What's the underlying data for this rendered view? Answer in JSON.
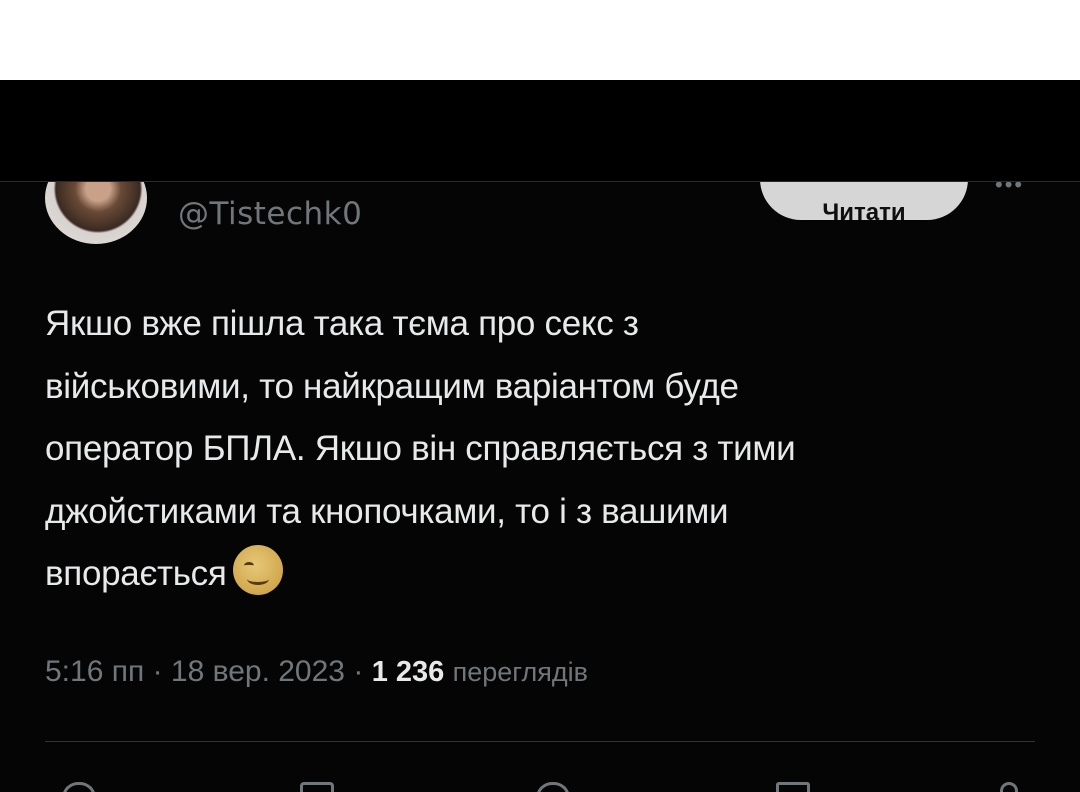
{
  "profile": {
    "handle": "@Tistechk0",
    "follow_button_label": "Читати"
  },
  "tweet": {
    "text_lines": [
      "Якшо вже пішла така тєма про секс з",
      "військовими, то найкращим варіантом буде",
      "оператор БПЛА. Якшо він справляється з тими",
      "джойстиками та кнопочками, то і з вашими",
      "впорається"
    ],
    "emoji": "winking-face"
  },
  "meta": {
    "time": "5:16 пп",
    "separator": "·",
    "date": "18 вер. 2023",
    "views_count": "1 236",
    "views_label": "переглядів"
  },
  "icons": [
    "more-dots-icon",
    "reply-icon",
    "retweet-icon",
    "like-icon",
    "bookmark-icon",
    "share-icon"
  ]
}
